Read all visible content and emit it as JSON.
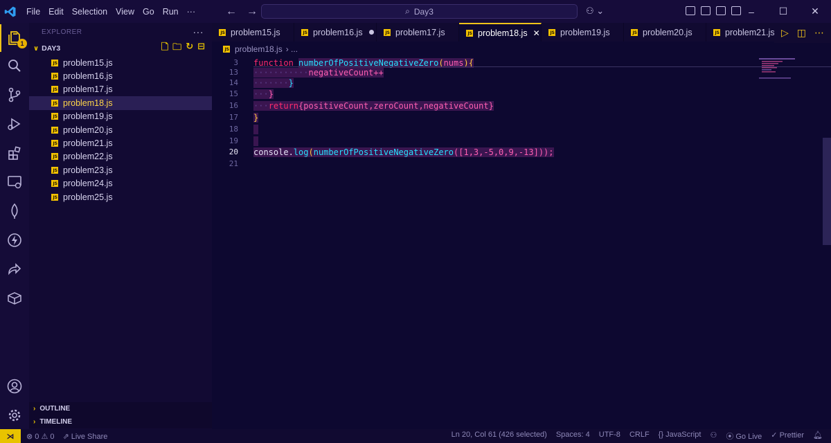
{
  "menu": [
    "File",
    "Edit",
    "Selection",
    "View",
    "Go",
    "Run",
    "···"
  ],
  "search": {
    "text": "Day3"
  },
  "window_controls": [
    "–",
    "☐",
    "✕"
  ],
  "activity": {
    "badge": "1"
  },
  "sidebar": {
    "title": "EXPLORER",
    "more": "···",
    "folder": "DAY3",
    "files": [
      "problem15.js",
      "problem16.js",
      "problem17.js",
      "problem18.js",
      "problem19.js",
      "problem20.js",
      "problem21.js",
      "problem22.js",
      "problem23.js",
      "problem24.js",
      "problem25.js"
    ],
    "outline": "OUTLINE",
    "timeline": "TIMELINE"
  },
  "tabs": [
    {
      "label": "problem15.js"
    },
    {
      "label": "problem16.js"
    },
    {
      "label": "problem17.js"
    },
    {
      "label": "problem18.js"
    },
    {
      "label": "problem19.js"
    },
    {
      "label": "problem20.js"
    },
    {
      "label": "problem21.js"
    }
  ],
  "breadcrumb": {
    "file": "problem18.js",
    "rest": "› ..."
  },
  "editor": {
    "line_numbers": [
      "3",
      "13",
      "14",
      "15",
      "16",
      "17",
      "18",
      "19",
      "20",
      "21"
    ],
    "code": {
      "l3_kw": "function",
      "l3_fn": "numberOfPositiveNegativeZero",
      "l3_paren": "(",
      "l3_arg": "nums",
      "l3_end": "){",
      "l13": "negativeCount++",
      "l14": "}",
      "l15": "}",
      "l16_kw": "return",
      "l16_b1": "{",
      "l16_body": "positiveCount,zeroCount,negativeCount",
      "l16_b2": "}",
      "l17": "}",
      "l20_obj": "console.",
      "l20_log": "log",
      "l20_p1": "(",
      "l20_fn": "numberOfPositiveNegativeZero",
      "l20_arr": "([1,3,-5,0,9,-13]));"
    }
  },
  "status": {
    "errors": "⊗ 0 ⚠ 0",
    "liveshare": "Live Share",
    "position": "Ln 20, Col 61 (426 selected)",
    "spaces": "Spaces: 4",
    "encoding": "UTF-8",
    "eol": "CRLF",
    "language": "{} JavaScript",
    "golive": "Go Live",
    "prettier": "✓ Prettier"
  },
  "colors": {
    "accent": "#f0c419",
    "background": "#0d0830",
    "keyword": "#ff2a6d",
    "function": "#27e0ff"
  }
}
